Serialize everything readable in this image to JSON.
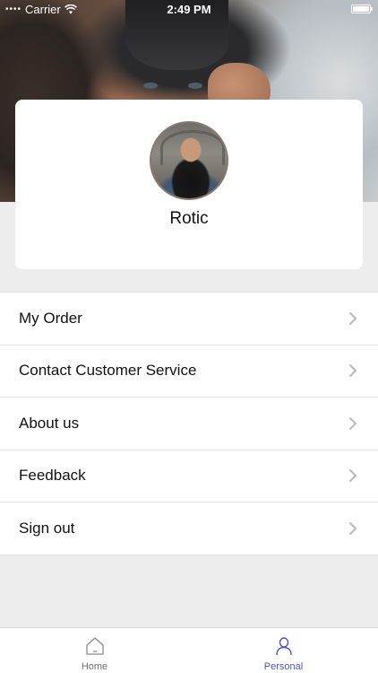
{
  "status_bar": {
    "carrier": "Carrier",
    "time": "2:49 PM"
  },
  "profile": {
    "username": "Rotic"
  },
  "menu": {
    "items": [
      {
        "label": "My Order"
      },
      {
        "label": "Contact Customer Service"
      },
      {
        "label": "About us"
      },
      {
        "label": "Feedback"
      },
      {
        "label": "Sign out"
      }
    ]
  },
  "tabbar": {
    "home_label": "Home",
    "personal_label": "Personal",
    "active": "personal",
    "active_color": "#4756b8",
    "inactive_color": "#6f6f6f"
  },
  "icons": {
    "home": "home-icon",
    "personal": "person-icon",
    "chevron": "chevron-right-icon",
    "wifi": "wifi-icon",
    "battery": "battery-icon"
  }
}
